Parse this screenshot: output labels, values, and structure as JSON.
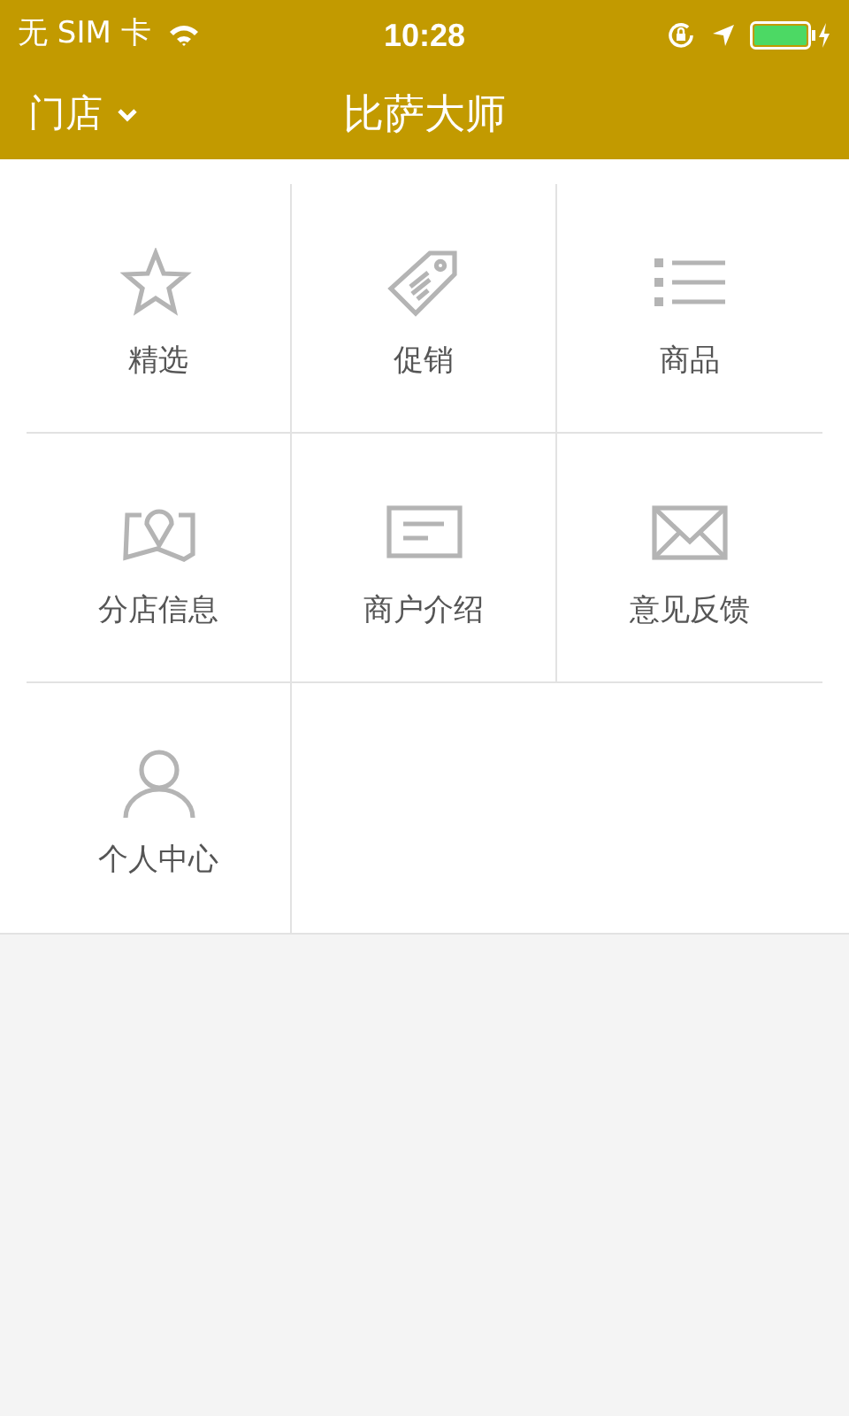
{
  "status_bar": {
    "carrier": "无 SIM 卡",
    "time": "10:28"
  },
  "header": {
    "store_menu": "门店",
    "title": "比萨大师"
  },
  "menu_items": [
    {
      "label": "精选",
      "kind": "star"
    },
    {
      "label": "促销",
      "kind": "tag"
    },
    {
      "label": "商品",
      "kind": "list"
    },
    {
      "label": "分店信息",
      "kind": "map"
    },
    {
      "label": "商户介绍",
      "kind": "card"
    },
    {
      "label": "意见反馈",
      "kind": "mail"
    },
    {
      "label": "个人中心",
      "kind": "person"
    }
  ]
}
